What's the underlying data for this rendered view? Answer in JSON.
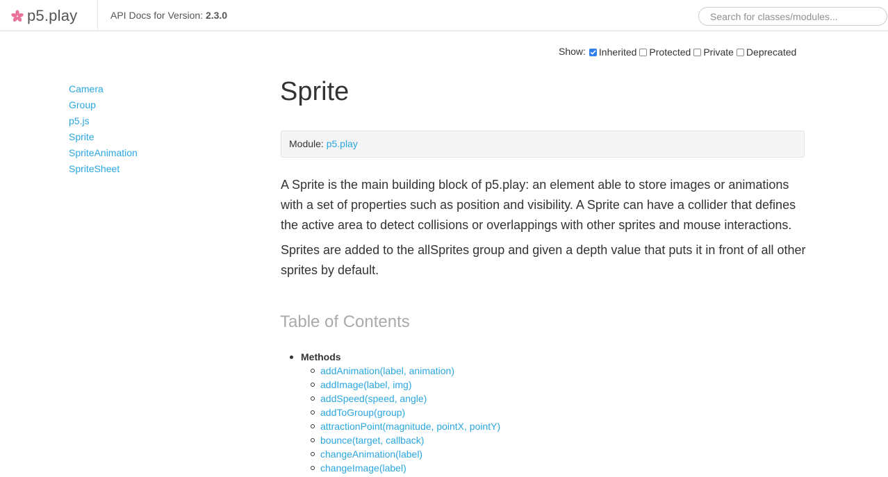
{
  "header": {
    "logo_text": "p5.play",
    "logo_icon": "pink-asterisk-icon",
    "version_prefix": "API Docs for Version:",
    "version": "2.3.0",
    "search_placeholder": "Search for classes/modules..."
  },
  "show_filters": {
    "label": "Show:",
    "options": [
      {
        "label": "Inherited",
        "checked": true
      },
      {
        "label": "Protected",
        "checked": false
      },
      {
        "label": "Private",
        "checked": false
      },
      {
        "label": "Deprecated",
        "checked": false
      }
    ]
  },
  "sidebar": {
    "items": [
      "Camera",
      "Group",
      "p5.js",
      "Sprite",
      "SpriteAnimation",
      "SpriteSheet"
    ]
  },
  "main": {
    "title": "Sprite",
    "module_label": "Module:",
    "module_link": "p5.play",
    "description": [
      "A Sprite is the main building block of p5.play: an element able to store images or animations with a set of properties such as position and visibility. A Sprite can have a collider that defines the active area to detect collisions or overlappings with other sprites and mouse interactions.",
      "Sprites are added to the allSprites group and given a depth value that puts it in front of all other sprites by default."
    ],
    "toc_title": "Table of Contents",
    "toc_section": "Methods",
    "methods": [
      "addAnimation(label, animation)",
      "addImage(label, img)",
      "addSpeed(speed, angle)",
      "addToGroup(group)",
      "attractionPoint(magnitude, pointX, pointY)",
      "bounce(target, callback)",
      "changeAnimation(label)",
      "changeImage(label)"
    ]
  },
  "colors": {
    "link": "#2aa7df",
    "logo_pink": "#e8729a",
    "checkbox_checked": "#2f80ed"
  }
}
